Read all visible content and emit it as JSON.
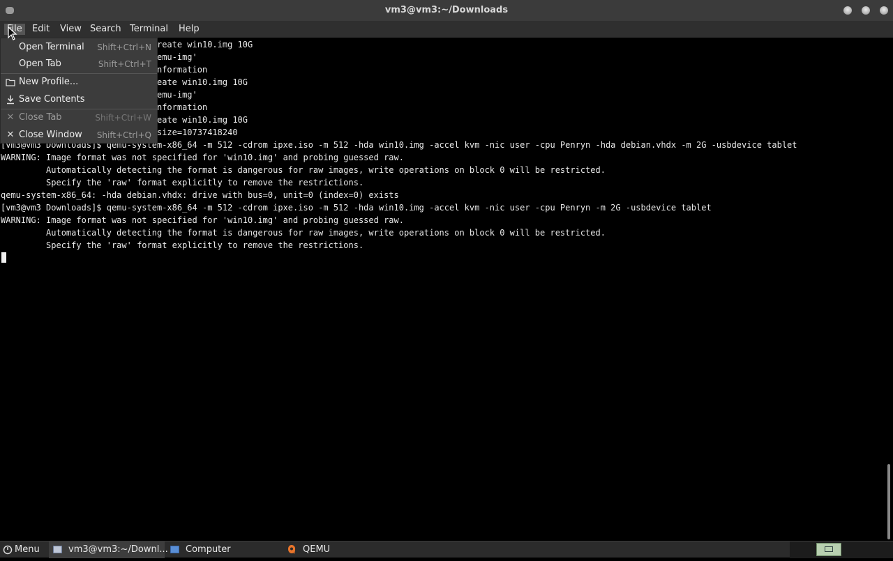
{
  "window": {
    "title": "vm3@vm3:~/Downloads"
  },
  "menubar": [
    "File",
    "Edit",
    "View",
    "Search",
    "Terminal",
    "Help"
  ],
  "file_menu": {
    "items": [
      {
        "label": "Open Terminal",
        "shortcut": "Shift+Ctrl+N",
        "icon": "",
        "enabled": true
      },
      {
        "label": "Open Tab",
        "shortcut": "Shift+Ctrl+T",
        "icon": "",
        "enabled": true
      },
      {
        "label": "New Profile...",
        "shortcut": "",
        "icon": "folder-icon",
        "enabled": true
      },
      {
        "label": "Save Contents",
        "shortcut": "",
        "icon": "download-icon",
        "enabled": true
      },
      {
        "label": "Close Tab",
        "shortcut": "Shift+Ctrl+W",
        "icon": "close-icon",
        "enabled": false
      },
      {
        "label": "Close Window",
        "shortcut": "Shift+Ctrl+Q",
        "icon": "close-icon",
        "enabled": true
      }
    ]
  },
  "terminal": {
    "lines": [
      "                           g -create win10.img 10G",
      "                           n 'qemu-img'",
      "                           re information",
      "                           g -reate win10.img 10G",
      "                           n 'qemu-img'",
      "                           re information",
      "                           g create win10.img 10G",
      "                           raw size=10737418240",
      "[vm3@vm3 Downloads]$ qemu-system-x86_64 -m 512 -cdrom ipxe.iso -m 512 -hda win10.img -accel kvm -nic user -cpu Penryn -hda debian.vhdx -m 2G -usbdevice tablet",
      "WARNING: Image format was not specified for 'win10.img' and probing guessed raw.",
      "         Automatically detecting the format is dangerous for raw images, write operations on block 0 will be restricted.",
      "         Specify the 'raw' format explicitly to remove the restrictions.",
      "qemu-system-x86_64: -hda debian.vhdx: drive with bus=0, unit=0 (index=0) exists",
      "[vm3@vm3 Downloads]$ qemu-system-x86_64 -m 512 -cdrom ipxe.iso -m 512 -hda win10.img -accel kvm -nic user -cpu Penryn -m 2G -usbdevice tablet",
      "WARNING: Image format was not specified for 'win10.img' and probing guessed raw.",
      "         Automatically detecting the format is dangerous for raw images, write operations on block 0 will be restricted.",
      "         Specify the 'raw' format explicitly to remove the restrictions."
    ]
  },
  "taskbar": {
    "menu_label": "Menu",
    "tasks": [
      {
        "label": "vm3@vm3:~/Downl...",
        "icon": "terminal-window-icon",
        "active": true
      },
      {
        "label": "Computer",
        "icon": "computer-icon",
        "active": false
      },
      {
        "label": "QEMU",
        "icon": "qemu-icon",
        "active": false
      }
    ]
  }
}
